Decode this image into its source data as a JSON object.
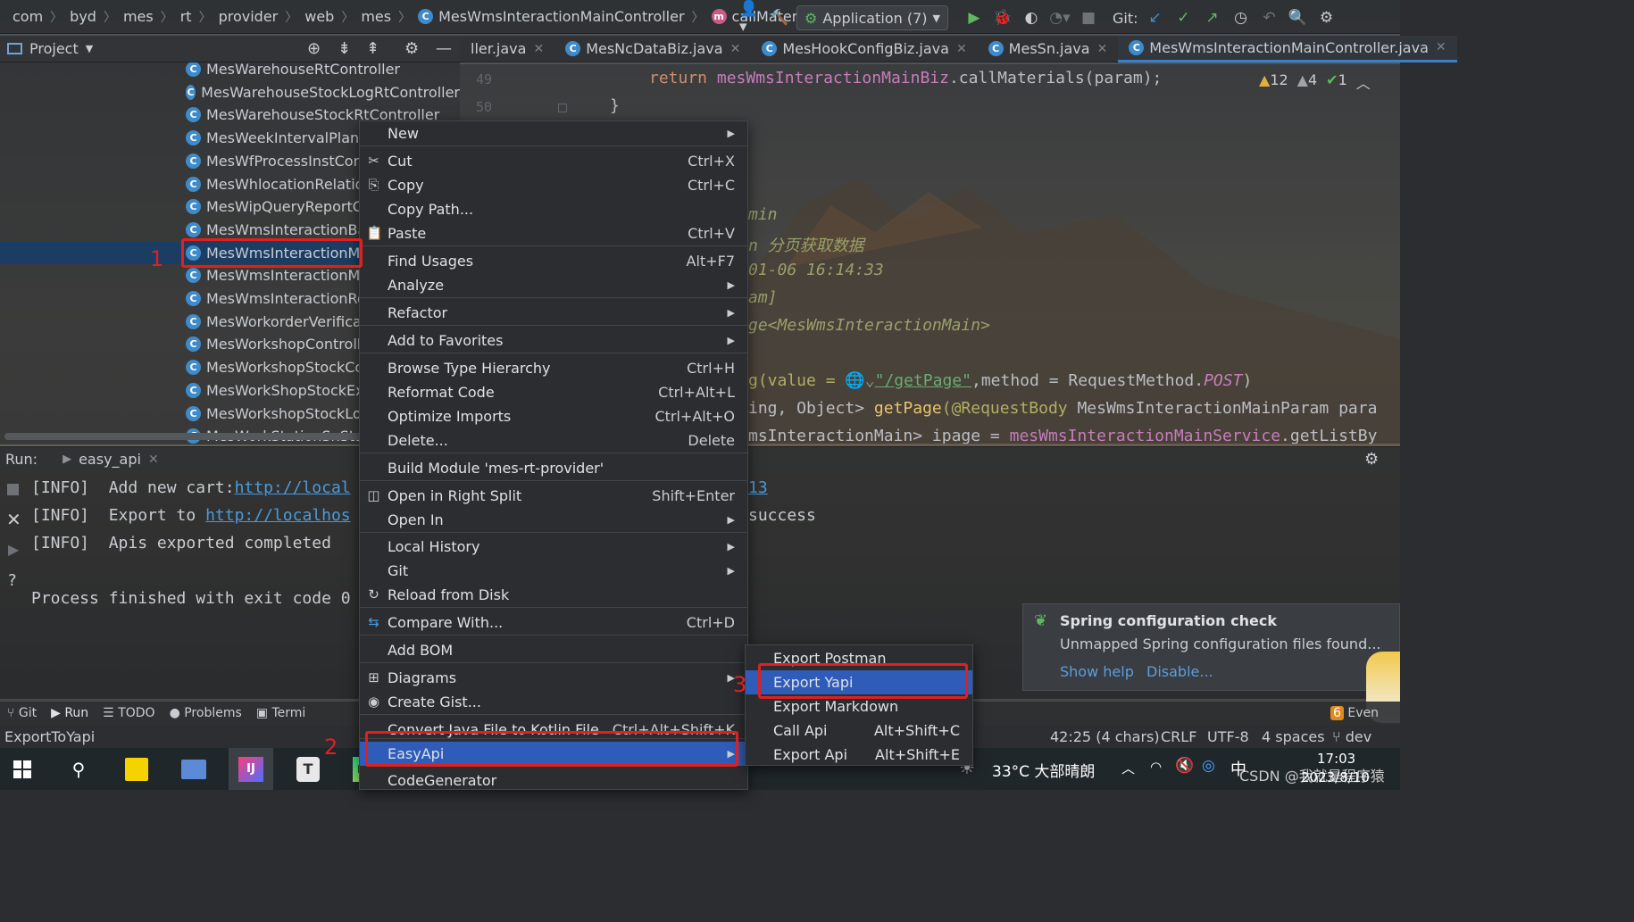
{
  "breadcrumb": [
    "com",
    "byd",
    "mes",
    "rt",
    "provider",
    "web",
    "mes"
  ],
  "breadcrumb_class": "MesWmsInteractionMainController",
  "breadcrumb_method": "callMaterials",
  "toolbar": {
    "run_config": "Application (7)",
    "git_label": "Git:"
  },
  "project_panel": {
    "title": "Project",
    "items": [
      "MesWarehouseRtController",
      "MesWarehouseStockLogRtController",
      "MesWarehouseStockRtController",
      "MesWeekIntervalPlanC",
      "MesWfProcessInstCont",
      "MesWhlocationRelatio",
      "MesWipQueryReportC",
      "MesWmsInteractionBa",
      "MesWmsInteractionMa",
      "MesWmsInteractionMa",
      "MesWmsInteractionRo",
      "MesWorkorderVerificat",
      "MesWorkshopControll",
      "MesWorkshopStockCo",
      "MesWorkShopStockExi",
      "MesWorkshopStockLog",
      "MesWorkStationSnStac"
    ],
    "selected_index": 8
  },
  "editor_tabs": [
    {
      "label": "ller.java",
      "active": false
    },
    {
      "label": "MesNcDataBiz.java",
      "active": false
    },
    {
      "label": "MesHookConfigBiz.java",
      "active": false
    },
    {
      "label": "MesSn.java",
      "active": false
    },
    {
      "label": "MesWmsInteractionMainController.java",
      "active": true
    }
  ],
  "editor": {
    "line_numbers": [
      "49",
      "50"
    ],
    "code_line1_kw": "return",
    "code_line1_field": "mesWmsInteractionMainBiz",
    "code_line1_rest": ".callMaterials(param);",
    "code_line2": "}",
    "inspections": {
      "warnings": "12",
      "weak_warnings": "4",
      "ok": "1"
    },
    "partial_lines": [
      {
        "text": "min",
        "style": "comment"
      },
      {
        "text": "n 分页获取数据",
        "style": "comment"
      },
      {
        "text": "01-06 16:14:33",
        "style": "comment"
      },
      {
        "text": "am]",
        "style": "comment"
      },
      {
        "text": "ge<MesWmsInteractionMain>",
        "style": "comment"
      }
    ],
    "mapping_line": {
      "pre": "g(value = ",
      "path": "\"/getPage\"",
      "mid": ",method = RequestMethod.",
      "post_kw": "POST",
      "end": ")"
    },
    "signature_line": {
      "pre": "ing, Object> ",
      "fn": "getPage",
      "ann": "(@RequestBody ",
      "rest": "MesWmsInteractionMainParam para"
    },
    "service_line": {
      "pre": "msInteractionMain> ipage = ",
      "field": "mesWmsInteractionMainService",
      "rest": ".getListBy"
    }
  },
  "run_panel": {
    "label": "Run:",
    "tab": "easy_api",
    "lines": [
      {
        "prefix": "[INFO]  Add new cart:",
        "link": "http://local",
        "tail_link": "13"
      },
      {
        "prefix": "[INFO]  Export to ",
        "link": "http://localhos",
        "tail": "success"
      },
      {
        "prefix": "[INFO]  Apis exported completed"
      },
      {
        "prefix": ""
      },
      {
        "prefix": "Process finished with exit code 0"
      }
    ]
  },
  "tool_strip": [
    "Git",
    "Run",
    "TODO",
    "Problems",
    "Termi"
  ],
  "tool_strip_right": "Even",
  "status": {
    "left": "ExportToYapi",
    "position": "42:25 (4 chars)",
    "line_sep": "CRLF",
    "encoding": "UTF-8",
    "indent": "4 spaces",
    "branch": "dev"
  },
  "context_menu": {
    "items": [
      {
        "label": "New",
        "shortcut": "",
        "submenu": true
      },
      {
        "label": "Cut",
        "shortcut": "Ctrl+X",
        "icon": "scissors-icon"
      },
      {
        "label": "Copy",
        "shortcut": "Ctrl+C",
        "icon": "copy-icon"
      },
      {
        "label": "Copy Path...",
        "shortcut": ""
      },
      {
        "label": "Paste",
        "shortcut": "Ctrl+V",
        "icon": "paste-icon"
      },
      {
        "label": "Find Usages",
        "shortcut": "Alt+F7"
      },
      {
        "label": "Analyze",
        "shortcut": "",
        "submenu": true
      },
      {
        "label": "Refactor",
        "shortcut": "",
        "submenu": true
      },
      {
        "label": "Add to Favorites",
        "shortcut": "",
        "submenu": true
      },
      {
        "label": "Browse Type Hierarchy",
        "shortcut": "Ctrl+H"
      },
      {
        "label": "Reformat Code",
        "shortcut": "Ctrl+Alt+L"
      },
      {
        "label": "Optimize Imports",
        "shortcut": "Ctrl+Alt+O"
      },
      {
        "label": "Delete...",
        "shortcut": "Delete"
      },
      {
        "label": "Build Module 'mes-rt-provider'",
        "shortcut": ""
      },
      {
        "label": "Open in Right Split",
        "shortcut": "Shift+Enter",
        "icon": "split-icon"
      },
      {
        "label": "Open In",
        "shortcut": "",
        "submenu": true
      },
      {
        "label": "Local History",
        "shortcut": "",
        "submenu": true
      },
      {
        "label": "Git",
        "shortcut": "",
        "submenu": true
      },
      {
        "label": "Reload from Disk",
        "shortcut": "",
        "icon": "reload-icon"
      },
      {
        "label": "Compare With...",
        "shortcut": "Ctrl+D",
        "icon": "compare-icon"
      },
      {
        "label": "Add BOM",
        "shortcut": ""
      },
      {
        "label": "Diagrams",
        "shortcut": "",
        "submenu": true,
        "icon": "diagram-icon"
      },
      {
        "label": "Create Gist...",
        "shortcut": "",
        "icon": "github-icon"
      },
      {
        "label": "Convert Java File to Kotlin File",
        "shortcut": "Ctrl+Alt+Shift+K"
      },
      {
        "label": "EasyApi",
        "shortcut": "",
        "submenu": true,
        "highlighted": true
      },
      {
        "label": "CodeGenerator",
        "shortcut": ""
      }
    ]
  },
  "submenu": {
    "items": [
      {
        "label": "Export Postman",
        "shortcut": ""
      },
      {
        "label": "Export Yapi",
        "shortcut": "",
        "highlighted": true
      },
      {
        "label": "Export Markdown",
        "shortcut": ""
      },
      {
        "label": "Call Api",
        "shortcut": "Alt+Shift+C"
      },
      {
        "label": "Export Api",
        "shortcut": "Alt+Shift+E"
      }
    ]
  },
  "annotations": [
    "1",
    "2",
    "3"
  ],
  "notification": {
    "title": "Spring configuration check",
    "body": "Unmapped Spring configuration files found...",
    "action1": "Show help",
    "action2": "Disable..."
  },
  "taskbar": {
    "weather": "33°C 大部晴朗",
    "ime": "中",
    "time": "17:03",
    "date": "2023/8/10",
    "watermark": "CSDN @我就是程序猿"
  },
  "colors": {
    "accent": "#2e5cb8",
    "selection": "#1b3d63",
    "annotation_red": "#e02020",
    "link": "#4a9bdc",
    "keyword": "#cf8e6d",
    "field": "#c77dbb"
  }
}
